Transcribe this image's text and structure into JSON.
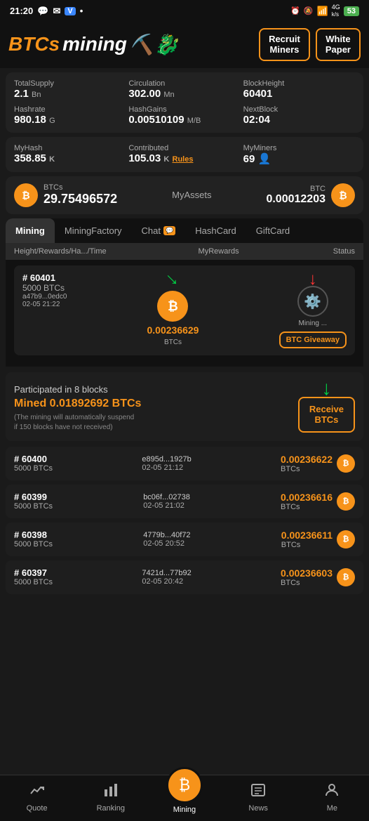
{
  "statusBar": {
    "time": "21:20",
    "icons": [
      "whatsapp",
      "email",
      "vpn",
      "dot"
    ]
  },
  "header": {
    "logo": "BTCs mining",
    "recruitBtn": "Recruit\nMiners",
    "whitePaperBtn": "White\nPaper"
  },
  "statsPanel": {
    "totalSupplyLabel": "TotalSupply",
    "totalSupplyValue": "2.1",
    "totalSupplyUnit": "Bn",
    "circulationLabel": "Circulation",
    "circulationValue": "302.00",
    "circulationUnit": "Mn",
    "blockHeightLabel": "BlockHeight",
    "blockHeightValue": "60401",
    "hashrateLabel": "Hashrate",
    "hashrateValue": "980.18",
    "hashrateUnit": "G",
    "hashGainsLabel": "HashGains",
    "hashGainsValue": "0.00510109",
    "hashGainsUnit": "M/B",
    "nextBlockLabel": "NextBlock",
    "nextBlockValue": "02:04"
  },
  "myStats": {
    "myHashLabel": "MyHash",
    "myHashValue": "358.85",
    "myHashUnit": "K",
    "contributedLabel": "Contributed",
    "contributedValue": "105.03",
    "contributedUnit": "K",
    "rulesLink": "Rules",
    "myMinersLabel": "MyMiners",
    "myMinersValue": "69",
    "myMinersIcon": "👤"
  },
  "assets": {
    "btcsLabel": "BTCs",
    "btcsValue": "29.75496572",
    "myAssetsLabel": "MyAssets",
    "btcLabel": "BTC",
    "btcValue": "0.00012203"
  },
  "tabs": [
    {
      "id": "mining",
      "label": "Mining",
      "active": true
    },
    {
      "id": "miningfactory",
      "label": "MiningFactory",
      "active": false
    },
    {
      "id": "chat",
      "label": "Chat",
      "badge": "💬",
      "active": false
    },
    {
      "id": "hashcard",
      "label": "HashCard",
      "active": false
    },
    {
      "id": "giftcard",
      "label": "GiftCard",
      "active": false
    }
  ],
  "tableHeader": {
    "col1": "Height/Rewards/Ha.../Time",
    "col2": "MyRewards",
    "col3": "Status"
  },
  "currentBlock": {
    "number": "# 60401",
    "btcs": "5000 BTCs",
    "hash": "a47b9...0edc0",
    "time": "02-05 21:22",
    "amount": "0.00236629",
    "amountLabel": "BTCs",
    "giveaway": "BTC Giveaway",
    "statusLabel": "Mining ..."
  },
  "participated": {
    "title": "Participated in 8 blocks",
    "minedLabel": "Mined 0.01892692 BTCs",
    "note": "(The mining will automatically suspend\nif 150 blocks have not received)",
    "receiveBtn": "Receive\nBTCs"
  },
  "blockList": [
    {
      "number": "# 60400",
      "btcs": "5000 BTCs",
      "hash": "e895d...1927b",
      "time": "02-05 21:12",
      "amount": "0.00236622",
      "unit": "BTCs"
    },
    {
      "number": "# 60399",
      "btcs": "5000 BTCs",
      "hash": "bc06f...02738",
      "time": "02-05 21:02",
      "amount": "0.00236616",
      "unit": "BTCs"
    },
    {
      "number": "# 60398",
      "btcs": "5000 BTCs",
      "hash": "4779b...40f72",
      "time": "02-05 20:52",
      "amount": "0.00236611",
      "unit": "BTCs"
    },
    {
      "number": "# 60397",
      "btcs": "5000 BTCs",
      "hash": "7421d...77b92",
      "time": "02-05 20:42",
      "amount": "0.00236603",
      "unit": "BTCs"
    }
  ],
  "bottomNav": [
    {
      "id": "quote",
      "label": "Quote",
      "icon": "📈",
      "active": false
    },
    {
      "id": "ranking",
      "label": "Ranking",
      "icon": "📊",
      "active": false
    },
    {
      "id": "mining",
      "label": "Mining",
      "icon": "mining",
      "active": true
    },
    {
      "id": "news",
      "label": "News",
      "icon": "📰",
      "active": false
    },
    {
      "id": "me",
      "label": "Me",
      "icon": "👤",
      "active": false
    }
  ]
}
